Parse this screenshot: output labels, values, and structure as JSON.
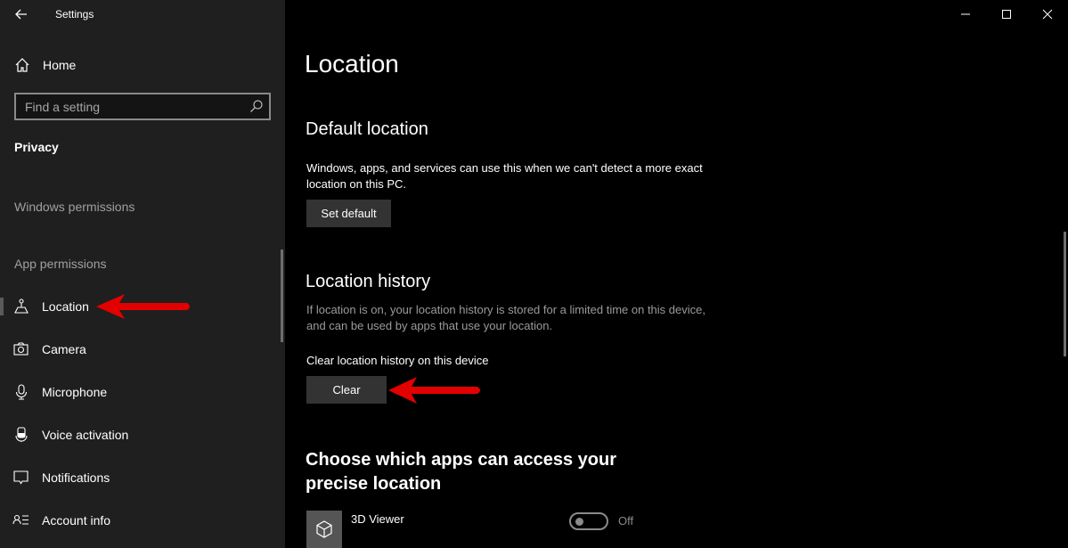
{
  "window": {
    "title": "Settings",
    "controls": {
      "minimize": "minimize-icon",
      "maximize": "maximize-icon",
      "close": "close-icon"
    }
  },
  "sidebar": {
    "back_icon": "back-arrow-icon",
    "home": {
      "label": "Home",
      "icon": "home-icon"
    },
    "search": {
      "placeholder": "Find a setting",
      "value": "",
      "icon": "search-icon"
    },
    "section_title": "Privacy",
    "groups": [
      {
        "label": "Windows permissions"
      },
      {
        "label": "App permissions"
      }
    ],
    "items": [
      {
        "label": "Location",
        "icon": "location-icon",
        "selected": true
      },
      {
        "label": "Camera",
        "icon": "camera-icon",
        "selected": false
      },
      {
        "label": "Microphone",
        "icon": "microphone-icon",
        "selected": false
      },
      {
        "label": "Voice activation",
        "icon": "voice-activation-icon",
        "selected": false
      },
      {
        "label": "Notifications",
        "icon": "notifications-icon",
        "selected": false
      },
      {
        "label": "Account info",
        "icon": "account-info-icon",
        "selected": false
      }
    ]
  },
  "main": {
    "page_title": "Location",
    "default_location": {
      "heading": "Default location",
      "description": "Windows, apps, and services can use this when we can't detect a more exact location on this PC.",
      "button_label": "Set default"
    },
    "location_history": {
      "heading": "Location history",
      "description": "If location is on, your location history is stored for a limited time on this device, and can be used by apps that use your location.",
      "clear_label": "Clear location history on this device",
      "button_label": "Clear"
    },
    "precise_location": {
      "heading": "Choose which apps can access your precise location",
      "apps": [
        {
          "name": "3D Viewer",
          "icon": "cube-icon",
          "toggle_state": "Off",
          "enabled": false
        }
      ]
    }
  },
  "annotations": {
    "arrow_color": "#e00000",
    "targets": [
      "sidebar-item-location",
      "clear-button"
    ]
  }
}
